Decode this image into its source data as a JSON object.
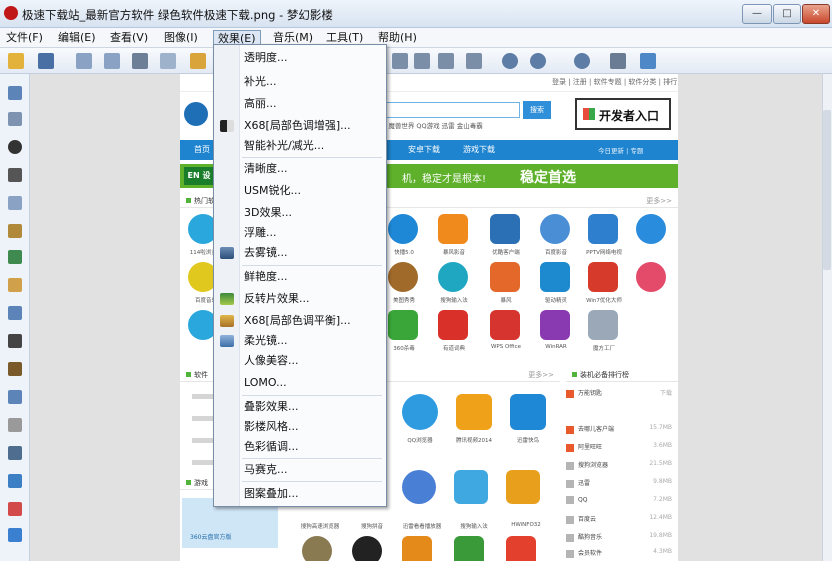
{
  "window": {
    "title": "极速下载站_最新官方软件 绿色软件极速下载.png - 梦幻影楼",
    "controls": {
      "minimize": "—",
      "maximize": "□",
      "close": "✕"
    }
  },
  "menubar": [
    {
      "label": "文件(F)"
    },
    {
      "label": "编辑(E)"
    },
    {
      "label": "查看(V)"
    },
    {
      "label": "图像(I)"
    },
    {
      "label": "效果(E)"
    },
    {
      "label": "音乐(M)"
    },
    {
      "label": "工具(T)"
    },
    {
      "label": "帮助(H)"
    }
  ],
  "effects_menu": {
    "items": [
      {
        "label": "透明度..."
      },
      {
        "label": "补光..."
      },
      {
        "label": "高丽..."
      },
      {
        "label": "X68[局部色调增强]..."
      },
      {
        "label": "智能补光/减光..."
      },
      {
        "label": "清晰度..."
      },
      {
        "label": "USM锐化..."
      },
      {
        "label": "3D效果..."
      },
      {
        "label": "浮雕..."
      },
      {
        "label": "去雾镜..."
      },
      {
        "label": "鲜艳度..."
      },
      {
        "label": "反转片效果..."
      },
      {
        "label": "X68[局部色调平衡]..."
      },
      {
        "label": "柔光镜..."
      },
      {
        "label": "人像美容..."
      },
      {
        "label": "LOMO..."
      },
      {
        "label": "叠影效果..."
      },
      {
        "label": "影楼风格..."
      },
      {
        "label": "色彩循调..."
      },
      {
        "label": "马赛克..."
      },
      {
        "label": "图案叠加..."
      }
    ]
  },
  "image": {
    "header_links": "登录 | 注册 | 软件专题 | 软件分类 | 排行",
    "search_button": "搜索",
    "hot_words": "PPTV 魔兽世界 QQ游戏 迅雷 金山毒霸",
    "developer_button": "开发者入口",
    "nav": [
      "首页",
      "安卓下载",
      "游戏下载"
    ],
    "nav_right": "今日更新 | 专题",
    "banner_badge": "EN 设置",
    "banner_text": "机，稳定才是根本!",
    "banner_big": "稳定首选",
    "section_hot": "热门软件",
    "section_more": "更多>>",
    "section_soft": "软件",
    "section_rank": "装机必备排行榜",
    "section_game": "游戏",
    "icon_labels": [
      "114啦浏览器",
      "快播5.0",
      "暴风影音",
      "优酷客户端",
      "百度影音",
      "PPTV网络电视",
      "酷我音乐",
      "QQ浏览器",
      "腾讯视频",
      "迅雷看看",
      "360卫士"
    ],
    "icon_labels_row2": [
      "百度音乐",
      "美图秀秀",
      "搜狗输入法",
      "暴风",
      "驱动精灵",
      "Win7优化大师"
    ],
    "icon_labels_row3": [
      "360杀毒",
      "有道词典",
      "WPS Office",
      "WinRAR",
      "魔方工厂"
    ],
    "icon_labels_row4": [
      "QQ浏览器",
      "腾讯视频2014",
      "迅雷快鸟"
    ],
    "icon_labels_row5": [
      "搜狗高速浏览器",
      "搜狗拼音",
      "迅雷看看播放器",
      "搜狗输入法",
      "HWiNFO32"
    ],
    "rank_items": [
      "万能钥匙",
      "去哪儿客户端",
      "阿里旺旺",
      "搜狗浏览器",
      "迅雷",
      "QQ",
      "百度云",
      "酷狗音乐",
      "会员软件"
    ],
    "rank_sizes": [
      "下载",
      "15.7MB",
      "3.6MB",
      "21.5MB",
      "9.8MB",
      "7.2MB",
      "12.4MB",
      "19.8MB",
      "4.3MB"
    ],
    "promo_label": "360云盘官方版"
  },
  "colors": {
    "accent": "#1f84cf",
    "menu_border": "#7a8da6",
    "banner": "#5fb12c"
  }
}
